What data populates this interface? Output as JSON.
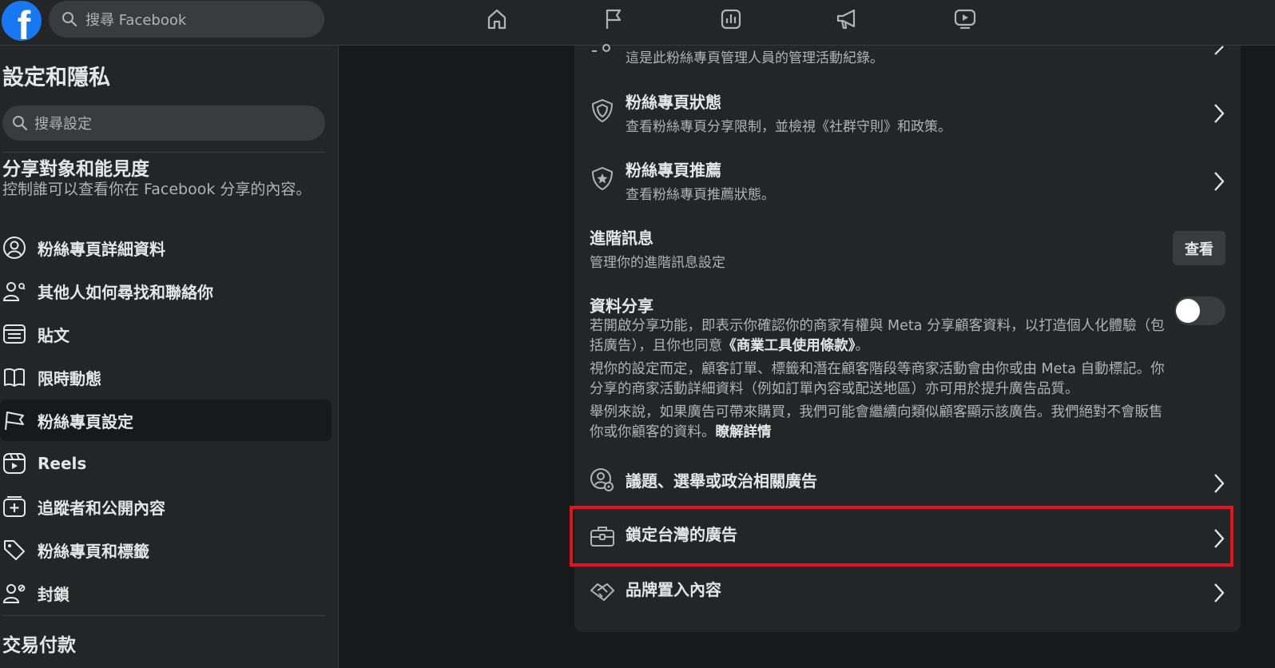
{
  "topbar": {
    "logo_letter": "f",
    "search_placeholder": "搜尋 Facebook",
    "nav_icons": [
      "home-icon",
      "flag-icon",
      "insights-icon",
      "megaphone-icon",
      "video-icon"
    ]
  },
  "sidebar": {
    "title": "設定和隱私",
    "search_placeholder": "搜尋設定",
    "section1_title": "分享對象和能見度",
    "section1_desc": "控制誰可以查看你在 Facebook 分享的內容。",
    "items": [
      {
        "label": "粉絲專頁詳細資料",
        "icon": "profile-circle-icon"
      },
      {
        "label": "其他人如何尋找和聯絡你",
        "icon": "person-contact-icon"
      },
      {
        "label": "貼文",
        "icon": "posts-icon"
      },
      {
        "label": "限時動態",
        "icon": "book-icon"
      },
      {
        "label": "粉絲專頁設定",
        "icon": "flag-icon"
      },
      {
        "label": "Reels",
        "icon": "reels-icon"
      },
      {
        "label": "追蹤者和公開內容",
        "icon": "add-box-icon"
      },
      {
        "label": "粉絲專頁和標籤",
        "icon": "tag-icon"
      },
      {
        "label": "封鎖",
        "icon": "block-person-icon"
      }
    ],
    "section2_title": "交易付款"
  },
  "main": {
    "partial_row_desc": "這是此粉絲專頁管理人員的管理活動紀錄。",
    "page_status": {
      "title": "粉絲專頁狀態",
      "desc": "查看粉絲專頁分享限制，並檢視《社群守則》和政策。"
    },
    "page_recommend": {
      "title": "粉絲專頁推薦",
      "desc": "查看粉絲專頁推薦狀態。"
    },
    "advanced_messaging": {
      "title": "進階訊息",
      "desc": "管理你的進階訊息設定",
      "button": "查看"
    },
    "data_sharing": {
      "title": "資料分享",
      "p1_text": "若開啟分享功能，即表示你確認你的商家有權與 Meta 分享顧客資料，以打造個人化體驗（包括廣告），且你也同意",
      "p1_link": "《商業工具使用條款》",
      "p1_end": "。",
      "p2": "視你的設定而定，顧客訂單、標籤和潛在顧客階段等商家活動會由你或由 Meta 自動標記。你分享的商家活動詳細資料（例如訂單內容或配送地區）亦可用於提升廣告品質。",
      "p3_text": "舉例來說，如果廣告可帶來購買，我們可能會繼續向類似顧客顯示該廣告。我們絕對不會販售你或你顧客的資料。",
      "p3_link": "瞭解詳情",
      "toggle_on": false
    },
    "political_ads": {
      "title": "議題、選舉或政治相關廣告"
    },
    "taiwan_ads": {
      "title": "鎖定台灣的廣告"
    },
    "branded_content": {
      "title": "品牌置入內容"
    },
    "highlight_color": "#e4141e"
  }
}
